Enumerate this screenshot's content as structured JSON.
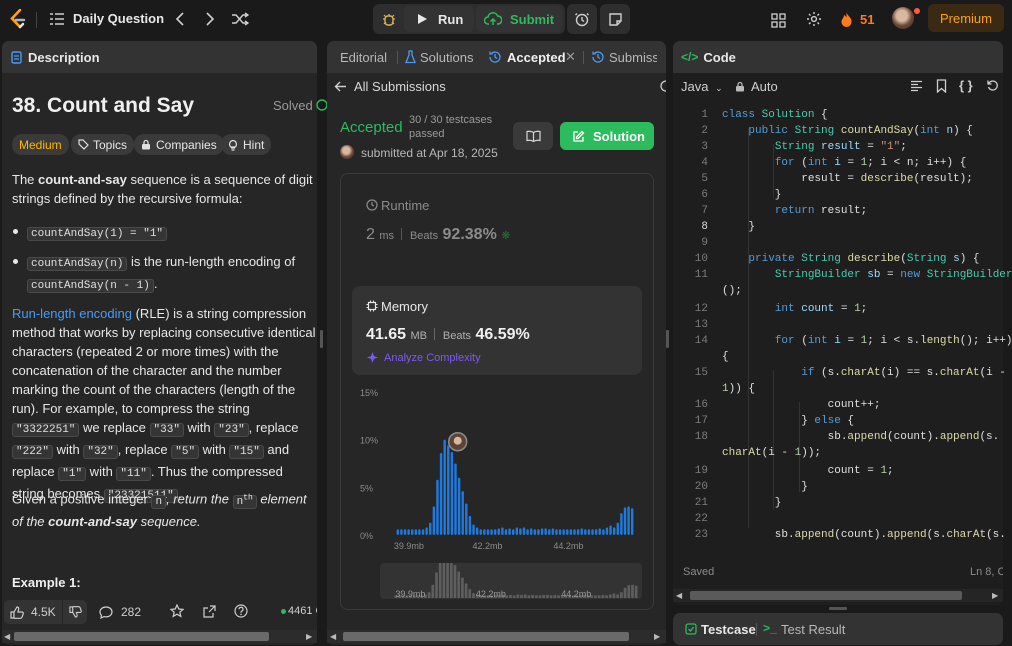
{
  "header": {
    "title": "Daily Question",
    "run_label": "Run",
    "submit_label": "Submit",
    "coins": "51",
    "premium_label": "Premium",
    "colors": {
      "run": "#e8e8e8",
      "submit": "#2cbb5d",
      "premium": "#ffa116",
      "coin": "#ff7a1a"
    }
  },
  "left": {
    "tab_label": "Description",
    "title": "38. Count and Say",
    "solved_label": "Solved",
    "tags": {
      "difficulty": "Medium",
      "topics": "Topics",
      "companies": "Companies",
      "hint": "Hint"
    },
    "para1": {
      "pre": "The ",
      "bold": "count-and-say",
      "post": " sequence is a sequence of digit strings defined by the recursive formula:"
    },
    "bullet1_code": "countAndSay(1) = \"1\"",
    "bullet2": {
      "code": "countAndSay(n)",
      "text": " is the run-length encoding of ",
      "code2": "countAndSay(n - 1)",
      "end": "."
    },
    "para2": {
      "link": "Run-length encoding",
      "t1": " (RLE) is a string compression method that works by replacing consecutive identical characters (repeated 2 or more times) with the concatenation of the character and the number marking the count of the characters (length of the run). For example, to compress the string ",
      "c1": "\"3322251\"",
      "t2": " we replace ",
      "c2": "\"33\"",
      "t3": " with ",
      "c3": "\"23\"",
      "t4": ", replace ",
      "c4": "\"222\"",
      "t5": " with ",
      "c5": "\"32\"",
      "t6": ", replace ",
      "c6": "\"5\"",
      "t7": " with ",
      "c7": "\"15\"",
      "t8": " and replace ",
      "c8": "\"1\"",
      "t9": " with ",
      "c9": "\"11\"",
      "t10": ". Thus the compressed string becomes ",
      "c10": "\"23321511\"",
      "t11": "."
    },
    "para3": {
      "t1": "Given a positive integer ",
      "c1": "n",
      "t2": ", return the ",
      "c2": "n",
      "sup": "th",
      "t3": " element of the ",
      "t4": "count-and-say",
      "t5": " sequence."
    },
    "example_heading": "Example 1:",
    "footer": {
      "likes": "4.5K",
      "comments": "282",
      "online": "4461 O"
    }
  },
  "middle": {
    "tabs": [
      {
        "label": "Editorial"
      },
      {
        "label": "Solutions"
      },
      {
        "label": "Accepted"
      },
      {
        "label": "Submiss"
      }
    ],
    "back_label": "All Submissions",
    "status": "Accepted",
    "testcases_line1": "30 / 30 testcases",
    "testcases_line2": "passed",
    "submitted": "submitted at Apr 18, 2025 18",
    "solution_label": "Solution",
    "runtime": {
      "label": "Runtime",
      "value": "2",
      "unit": "ms",
      "beats_label": "Beats",
      "beats": "92.38%"
    },
    "memory": {
      "label": "Memory",
      "value": "41.65",
      "unit": "MB",
      "beats_label": "Beats",
      "beats": "46.59%",
      "analyze": "Analyze Complexity"
    }
  },
  "chart_data": {
    "type": "bar",
    "title": "",
    "xlabel": "",
    "ylabel": "",
    "y_ticks": [
      "15%",
      "10%",
      "5%",
      "0%"
    ],
    "ylim": [
      0,
      15
    ],
    "x_ticks": [
      "39.9mb",
      "42.2mb",
      "44.2mb"
    ],
    "values": [
      0.6,
      0.6,
      0.6,
      0.6,
      0.6,
      0.6,
      0.6,
      0.6,
      0.8,
      1.3,
      3.0,
      5.8,
      8.6,
      10.0,
      9.4,
      8.7,
      7.5,
      6.0,
      4.6,
      3.3,
      2.0,
      1.1,
      0.8,
      0.6,
      0.6,
      0.6,
      0.6,
      0.6,
      0.7,
      0.8,
      0.6,
      0.7,
      0.6,
      0.8,
      0.7,
      0.8,
      0.6,
      0.7,
      0.6,
      0.6,
      0.7,
      0.7,
      0.6,
      0.7,
      0.6,
      0.6,
      0.6,
      0.6,
      0.6,
      0.6,
      0.6,
      0.7,
      0.6,
      0.6,
      0.6,
      0.6,
      0.7,
      0.6,
      0.8,
      1.0,
      0.8,
      1.3,
      2.3,
      2.9,
      3.0,
      2.8
    ],
    "highlight_index": 13,
    "bar_color": "#1f7ae0",
    "mini_x_ticks": [
      "39.9mb",
      "42.2mb",
      "44.2mb"
    ]
  },
  "editor": {
    "tab_label": "Code",
    "language": "Java",
    "mode": "Auto",
    "saved_label": "Saved",
    "cursor": "Ln 8, C",
    "line_numbers": [
      "1",
      "2",
      "3",
      "4",
      "5",
      "6",
      "7",
      "8",
      "9",
      "10",
      "11",
      "",
      "12",
      "13",
      "14",
      "",
      "15",
      "",
      "16",
      "17",
      "18",
      "",
      "19",
      "20",
      "21",
      "22",
      "23"
    ]
  },
  "bottom": {
    "testcase_label": "Testcase",
    "result_label": "Test Result"
  }
}
